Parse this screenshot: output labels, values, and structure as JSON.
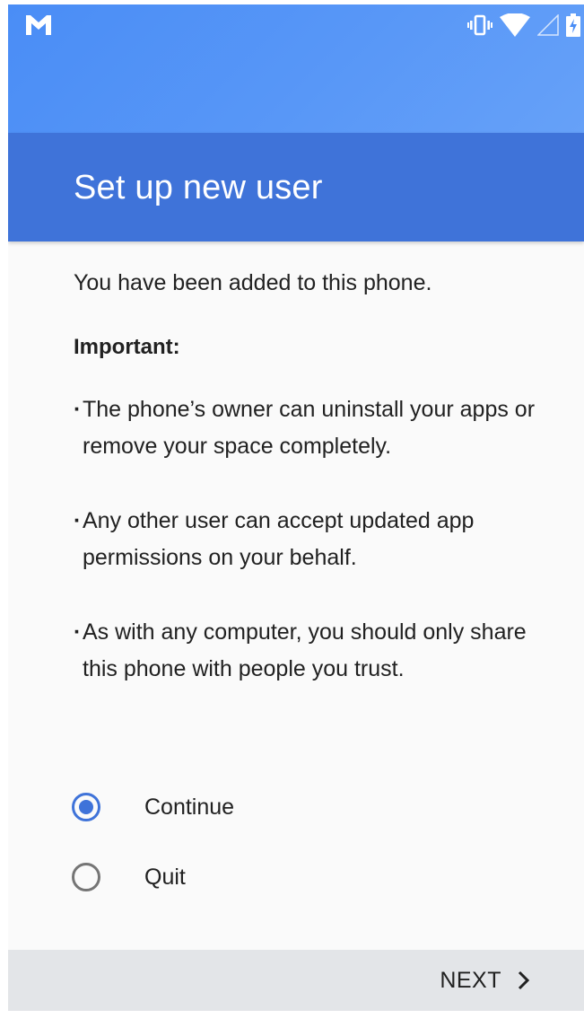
{
  "status_bar": {
    "notification_icon": "gmail-icon",
    "icons": [
      "vibrate-icon",
      "wifi-icon",
      "signal-icon",
      "battery-charging-icon"
    ]
  },
  "header": {
    "title": "Set up new user"
  },
  "content": {
    "intro": "You have been added to this phone.",
    "important_label": "Important:",
    "bullets": [
      {
        "dot": "·",
        "text": "The phone’s owner can uninstall your apps or remove your space completely."
      },
      {
        "dot": "·",
        "text": "Any other user can accept updated app permissions on your behalf."
      },
      {
        "dot": "·",
        "text": "As with any computer, you should only share this phone with people you trust."
      }
    ]
  },
  "options": [
    {
      "label": "Continue",
      "selected": true
    },
    {
      "label": "Quit",
      "selected": false
    }
  ],
  "footer": {
    "next_label": "NEXT",
    "next_icon": "chevron-right-icon"
  },
  "colors": {
    "accent": "#3f73d9",
    "status_bar": "#4a8df6",
    "footer": "#e3e5e8"
  }
}
